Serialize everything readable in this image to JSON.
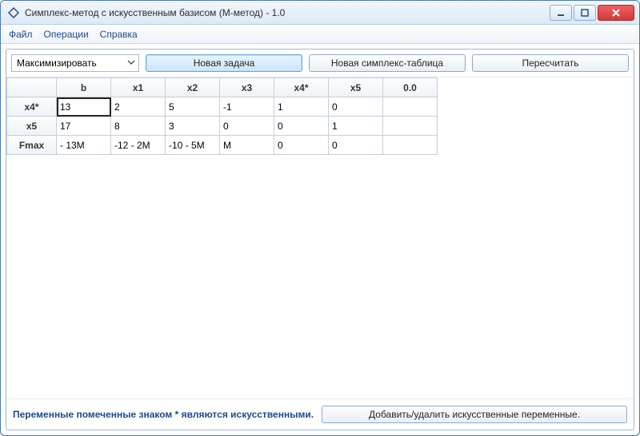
{
  "window": {
    "title": "Симплекс-метод с искусственным базисом (М-метод) - 1.0"
  },
  "menu": {
    "file": "Файл",
    "operations": "Операции",
    "help": "Справка"
  },
  "toolbar": {
    "mode_selected": "Максимизировать",
    "new_task": "Новая задача",
    "new_table": "Новая симплекс-таблица",
    "recalc": "Пересчитать"
  },
  "table": {
    "col_headers": [
      "b",
      "x1",
      "x2",
      "x3",
      "x4*",
      "x5",
      "0.0"
    ],
    "rows": [
      {
        "head": "x4*",
        "cells": [
          "13",
          "2",
          "5",
          "-1",
          "1",
          "0",
          ""
        ]
      },
      {
        "head": "x5",
        "cells": [
          "17",
          "8",
          "3",
          "0",
          "0",
          "1",
          ""
        ]
      },
      {
        "head": "Fmax",
        "cells": [
          "- 13M",
          "-12 - 2M",
          "-10 - 5M",
          "M",
          "0",
          "0",
          ""
        ]
      }
    ],
    "editing": {
      "row": 0,
      "col": 0
    }
  },
  "footer": {
    "hint": "Переменные помеченные знаком * являются искусственными.",
    "manage_button": "Добавить/удалить искусственные переменные."
  }
}
